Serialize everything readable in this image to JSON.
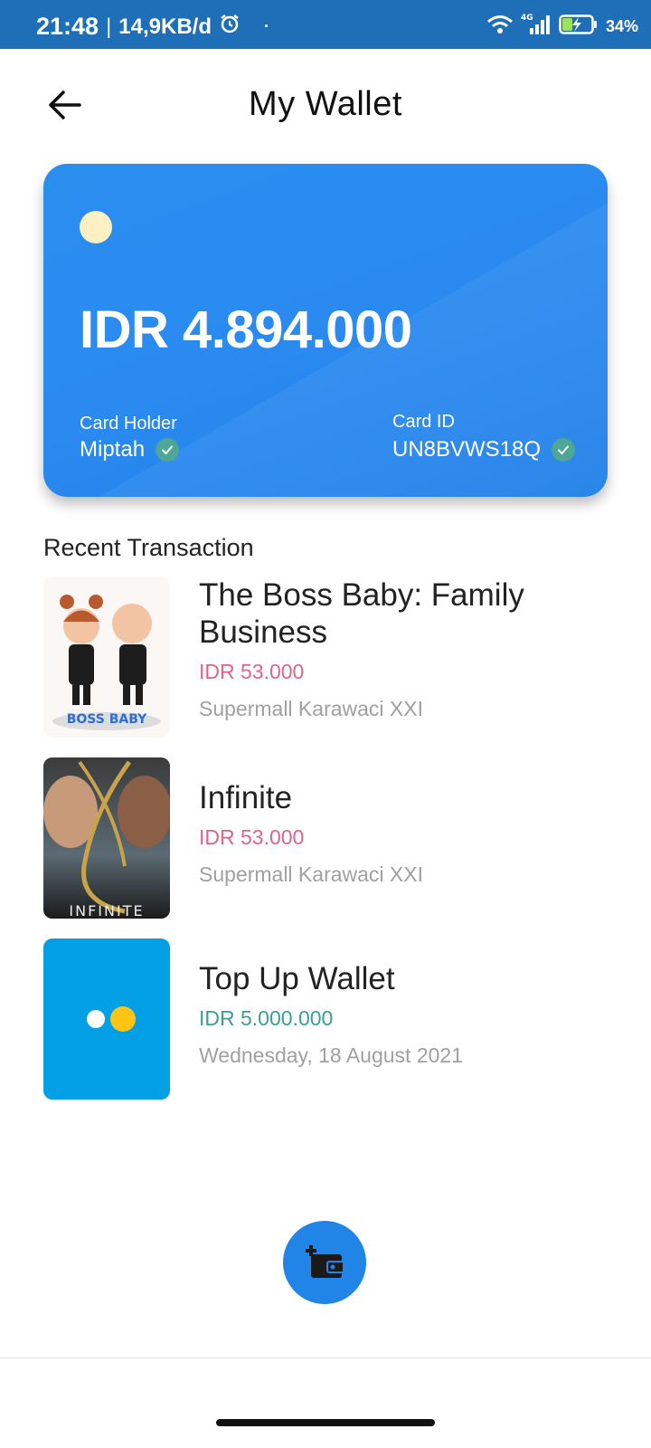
{
  "status_bar": {
    "time": "21:48",
    "separator": "|",
    "network_rate": "14,9KB/d",
    "dot": "·",
    "battery_pct": "34%",
    "icons": [
      "alarm-icon",
      "wifi-icon",
      "signal-4g-icon",
      "battery-charging-icon"
    ]
  },
  "header": {
    "title": "My Wallet",
    "back_icon": "arrow-left-icon"
  },
  "card": {
    "balance": "IDR 4.894.000",
    "holder_label": "Card Holder",
    "holder_name": "Miptah",
    "id_label": "Card ID",
    "id_value": "UN8BVWS18Q",
    "colors": {
      "card_bg": "#2b8eef",
      "chip": "#fdf0c2",
      "verified_badge": "#4ea795"
    }
  },
  "recent": {
    "title": "Recent Transaction",
    "items": [
      {
        "title": "The Boss Baby: Family Business",
        "amount": "IDR 53.000",
        "subtitle": "Supermall Karawaci XXI",
        "type": "expense",
        "poster_text": "BOSS BABY"
      },
      {
        "title": "Infinite",
        "amount": "IDR 53.000",
        "subtitle": "Supermall Karawaci XXI",
        "type": "expense",
        "poster_text": "INFINITE"
      },
      {
        "title": "Top Up Wallet",
        "amount": "IDR 5.000.000",
        "subtitle": "Wednesday, 18 August 2021",
        "type": "income"
      }
    ],
    "colors": {
      "expense": "#e0638a",
      "income": "#3a9e94"
    }
  },
  "fab": {
    "icon": "wallet-add-icon",
    "color": "#2185e8"
  }
}
